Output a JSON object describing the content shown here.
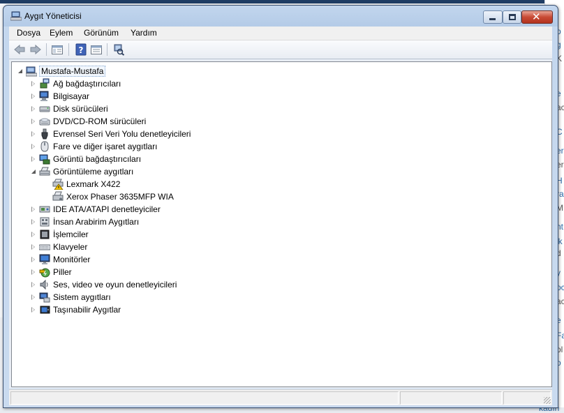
{
  "window": {
    "title": "Aygıt Yöneticisi"
  },
  "menubar": {
    "items": [
      "Dosya",
      "Eylem",
      "Görünüm",
      "Yardım"
    ]
  },
  "toolbar": {
    "buttons": [
      "back-arrow-icon",
      "forward-arrow-icon",
      "show-hide-console-tree-icon",
      "help-icon",
      "properties-icon",
      "scan-hardware-changes-icon"
    ]
  },
  "tree": {
    "root": "Mustafa-Mustafa",
    "items": [
      {
        "label": "Ağ bağdaştırıcıları",
        "icon": "network-adapter-icon"
      },
      {
        "label": "Bilgisayar",
        "icon": "computer-icon"
      },
      {
        "label": "Disk sürücüleri",
        "icon": "disk-drive-icon"
      },
      {
        "label": "DVD/CD-ROM sürücüleri",
        "icon": "dvd-drive-icon"
      },
      {
        "label": "Evrensel Seri Veri Yolu denetleyicileri",
        "icon": "usb-controller-icon"
      },
      {
        "label": "Fare ve diğer işaret aygıtları",
        "icon": "mouse-icon"
      },
      {
        "label": "Görüntü bağdaştırıcıları",
        "icon": "display-adapter-icon"
      },
      {
        "label": "Görüntüleme aygıtları",
        "icon": "imaging-device-icon",
        "expanded": true,
        "children": [
          {
            "label": "Lexmark X422",
            "icon": "scanner-warning-icon"
          },
          {
            "label": "Xerox Phaser 3635MFP WIA",
            "icon": "scanner-icon"
          }
        ]
      },
      {
        "label": "IDE ATA/ATAPI denetleyiciler",
        "icon": "ide-controller-icon"
      },
      {
        "label": "İnsan Arabirim Aygıtları",
        "icon": "hid-icon"
      },
      {
        "label": "İşlemciler",
        "icon": "processor-icon"
      },
      {
        "label": "Klavyeler",
        "icon": "keyboard-icon"
      },
      {
        "label": "Monitörler",
        "icon": "monitor-icon"
      },
      {
        "label": "Piller",
        "icon": "battery-icon"
      },
      {
        "label": "Ses, video ve oyun denetleyicileri",
        "icon": "sound-icon"
      },
      {
        "label": "Sistem aygıtları",
        "icon": "system-device-icon"
      },
      {
        "label": "Taşınabilir Aygıtlar",
        "icon": "portable-device-icon"
      }
    ]
  },
  "background": {
    "fragments": [
      "p",
      "g",
      "K",
      "i",
      "e",
      "ac",
      "C",
      "er",
      "er",
      "H",
      "ra",
      "M",
      "nt",
      "ik",
      "d",
      "y",
      "oc",
      "ac",
      "e",
      "Fa",
      "ol",
      "o"
    ],
    "bottom_text": "kadın"
  },
  "colors": {
    "titlebar": "#b4cbe7",
    "close_button": "#c84a35",
    "selection_border": "#7da2ce"
  }
}
